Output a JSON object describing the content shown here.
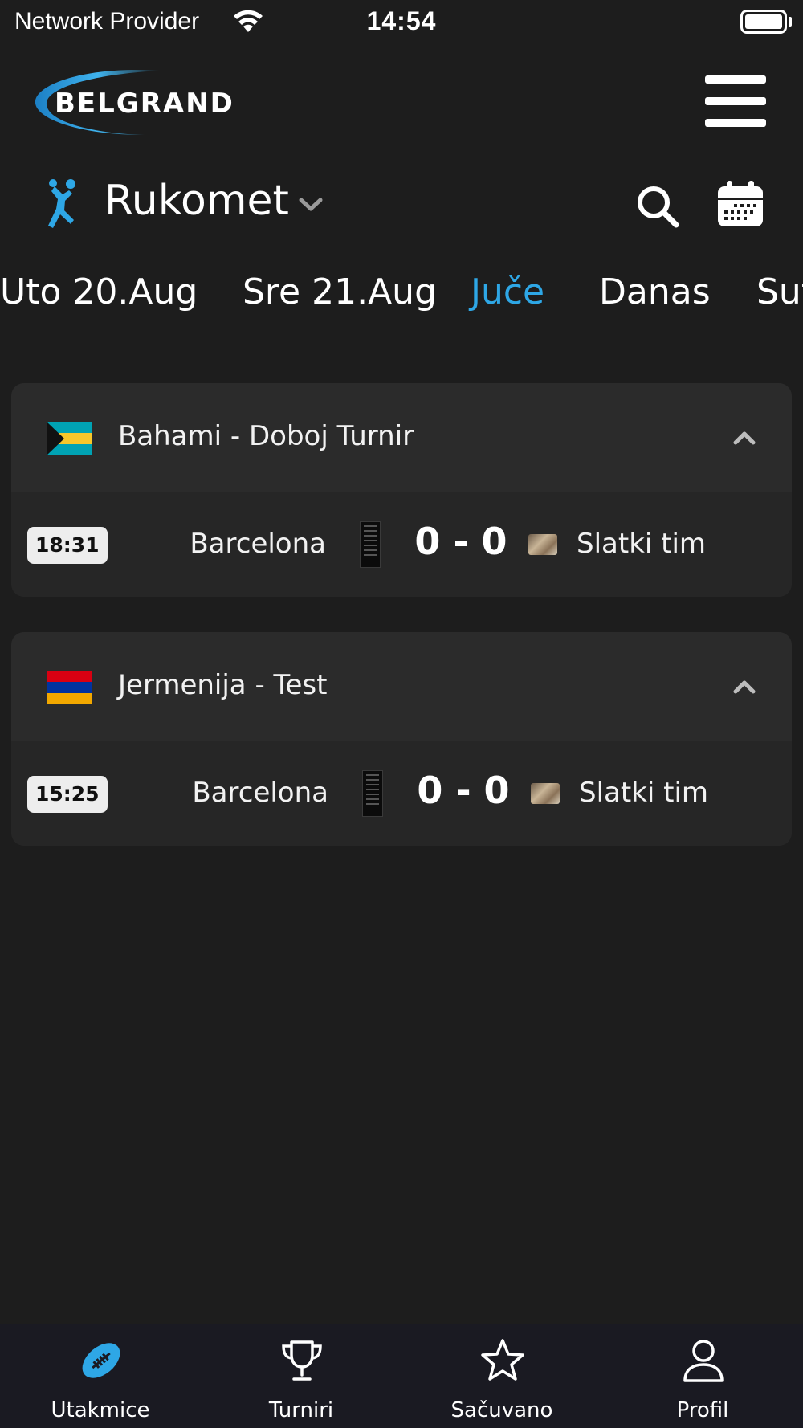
{
  "status_bar": {
    "carrier": "Network Provider",
    "time": "14:54"
  },
  "header": {
    "logo_text": "BELGRAND",
    "accent_color": "#2ea7e6"
  },
  "sport_selector": {
    "title": "Rukomet",
    "icon": "handball-player-icon"
  },
  "date_tabs": [
    {
      "label": "Uto 20.Aug",
      "active": false
    },
    {
      "label": "Sre 21.Aug",
      "active": false
    },
    {
      "label": "Juče",
      "active": true
    },
    {
      "label": "Danas",
      "active": false
    },
    {
      "label": "Sutra",
      "active": false
    }
  ],
  "leagues": [
    {
      "name": "Bahami - Doboj Turnir",
      "flag": "bahamas-flag",
      "matches": [
        {
          "time": "18:31",
          "home": "Barcelona",
          "score": "0 - 0",
          "away": "Slatki tim"
        }
      ]
    },
    {
      "name": "Jermenija - Test",
      "flag": "armenia-flag",
      "matches": [
        {
          "time": "15:25",
          "home": "Barcelona",
          "score": "0 - 0",
          "away": "Slatki tim"
        }
      ]
    }
  ],
  "bottom_nav": [
    {
      "label": "Utakmice",
      "icon": "football-icon",
      "active": true
    },
    {
      "label": "Turniri",
      "icon": "trophy-icon",
      "active": false
    },
    {
      "label": "Sačuvano",
      "icon": "star-icon",
      "active": false
    },
    {
      "label": "Profil",
      "icon": "user-icon",
      "active": false
    }
  ]
}
